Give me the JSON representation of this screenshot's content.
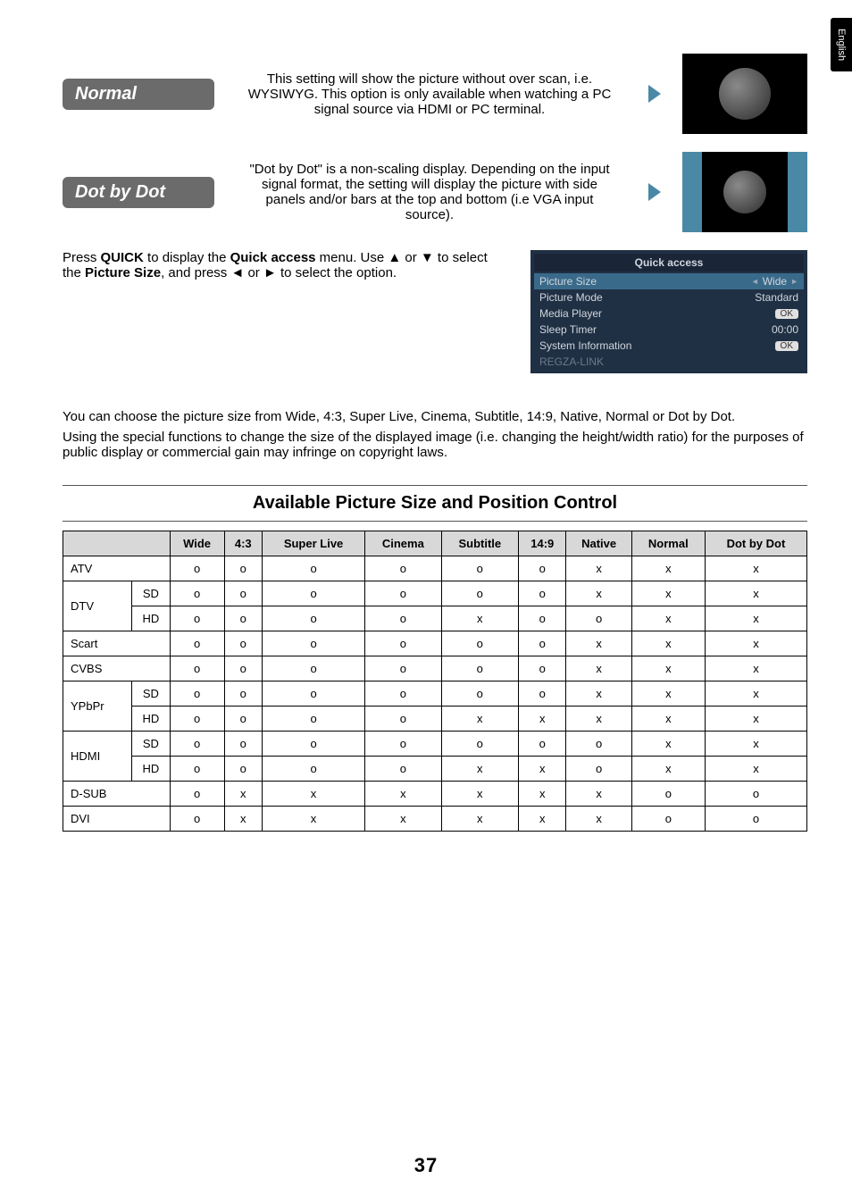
{
  "tab": "English",
  "modes": {
    "normal": {
      "label": "Normal",
      "desc": "This setting will show the picture without over scan, i.e. WYSIWYG. This option is only available when watching a PC signal source via HDMI or PC terminal."
    },
    "dotbydot": {
      "label": "Dot by Dot",
      "desc": "\"Dot by Dot\" is a non-scaling display. Depending on the input signal format, the setting will display the picture with side panels and/or bars at the top and bottom (i.e VGA input source)."
    }
  },
  "quick": {
    "intro_pre": "Press ",
    "quick_kw": "QUICK",
    "intro_mid": " to display the ",
    "quick_access_kw": "Quick access",
    "intro_post": " menu. Use ▲ or ▼ to select the ",
    "picture_size_kw": "Picture Size",
    "intro_tail": ", and press ◄ or ► to select the option.",
    "panel_title": "Quick access",
    "rows": {
      "picture_size": {
        "label": "Picture Size",
        "value": "Wide"
      },
      "picture_mode": {
        "label": "Picture Mode",
        "value": "Standard"
      },
      "media_player": {
        "label": "Media Player",
        "value": "OK"
      },
      "sleep_timer": {
        "label": "Sleep Timer",
        "value": "00:00"
      },
      "system_info": {
        "label": "System Information",
        "value": "OK"
      },
      "regza_link": {
        "label": "REGZA-LINK",
        "value": ""
      }
    }
  },
  "paragraph1": "You can choose the picture size from Wide, 4:3, Super Live, Cinema, Subtitle, 14:9, Native, Normal or Dot by Dot.",
  "paragraph2": "Using the special functions to change the size of the displayed image (i.e. changing the height/width ratio) for the purposes of public display or commercial gain may infringe on copyright laws.",
  "section_title": "Available Picture Size and Position Control",
  "table": {
    "headers": [
      "Wide",
      "4:3",
      "Super Live",
      "Cinema",
      "Subtitle",
      "14:9",
      "Native",
      "Normal",
      "Dot by Dot"
    ],
    "row_labels": {
      "atv": "ATV",
      "dtv": "DTV",
      "sd": "SD",
      "hd": "HD",
      "scart": "Scart",
      "cvbs": "CVBS",
      "ypbpr": "YPbPr",
      "hdmi": "HDMI",
      "dsub": "D-SUB",
      "dvi": "DVI"
    }
  },
  "chart_data": {
    "type": "table",
    "title": "Available Picture Size and Position Control",
    "columns": [
      "Wide",
      "4:3",
      "Super Live",
      "Cinema",
      "Subtitle",
      "14:9",
      "Native",
      "Normal",
      "Dot by Dot"
    ],
    "rows": [
      {
        "input": "ATV",
        "sub": "",
        "values": [
          "o",
          "o",
          "o",
          "o",
          "o",
          "o",
          "x",
          "x",
          "x"
        ]
      },
      {
        "input": "DTV",
        "sub": "SD",
        "values": [
          "o",
          "o",
          "o",
          "o",
          "o",
          "o",
          "x",
          "x",
          "x"
        ]
      },
      {
        "input": "DTV",
        "sub": "HD",
        "values": [
          "o",
          "o",
          "o",
          "o",
          "x",
          "o",
          "o",
          "x",
          "x"
        ]
      },
      {
        "input": "Scart",
        "sub": "",
        "values": [
          "o",
          "o",
          "o",
          "o",
          "o",
          "o",
          "x",
          "x",
          "x"
        ]
      },
      {
        "input": "CVBS",
        "sub": "",
        "values": [
          "o",
          "o",
          "o",
          "o",
          "o",
          "o",
          "x",
          "x",
          "x"
        ]
      },
      {
        "input": "YPbPr",
        "sub": "SD",
        "values": [
          "o",
          "o",
          "o",
          "o",
          "o",
          "o",
          "x",
          "x",
          "x"
        ]
      },
      {
        "input": "YPbPr",
        "sub": "HD",
        "values": [
          "o",
          "o",
          "o",
          "o",
          "x",
          "x",
          "x",
          "x",
          "x"
        ]
      },
      {
        "input": "HDMI",
        "sub": "SD",
        "values": [
          "o",
          "o",
          "o",
          "o",
          "o",
          "o",
          "o",
          "x",
          "x"
        ]
      },
      {
        "input": "HDMI",
        "sub": "HD",
        "values": [
          "o",
          "o",
          "o",
          "o",
          "x",
          "x",
          "o",
          "x",
          "x"
        ]
      },
      {
        "input": "D-SUB",
        "sub": "",
        "values": [
          "o",
          "x",
          "x",
          "x",
          "x",
          "x",
          "x",
          "o",
          "o"
        ]
      },
      {
        "input": "DVI",
        "sub": "",
        "values": [
          "o",
          "x",
          "x",
          "x",
          "x",
          "x",
          "x",
          "o",
          "o"
        ]
      }
    ]
  },
  "page_number": "37"
}
